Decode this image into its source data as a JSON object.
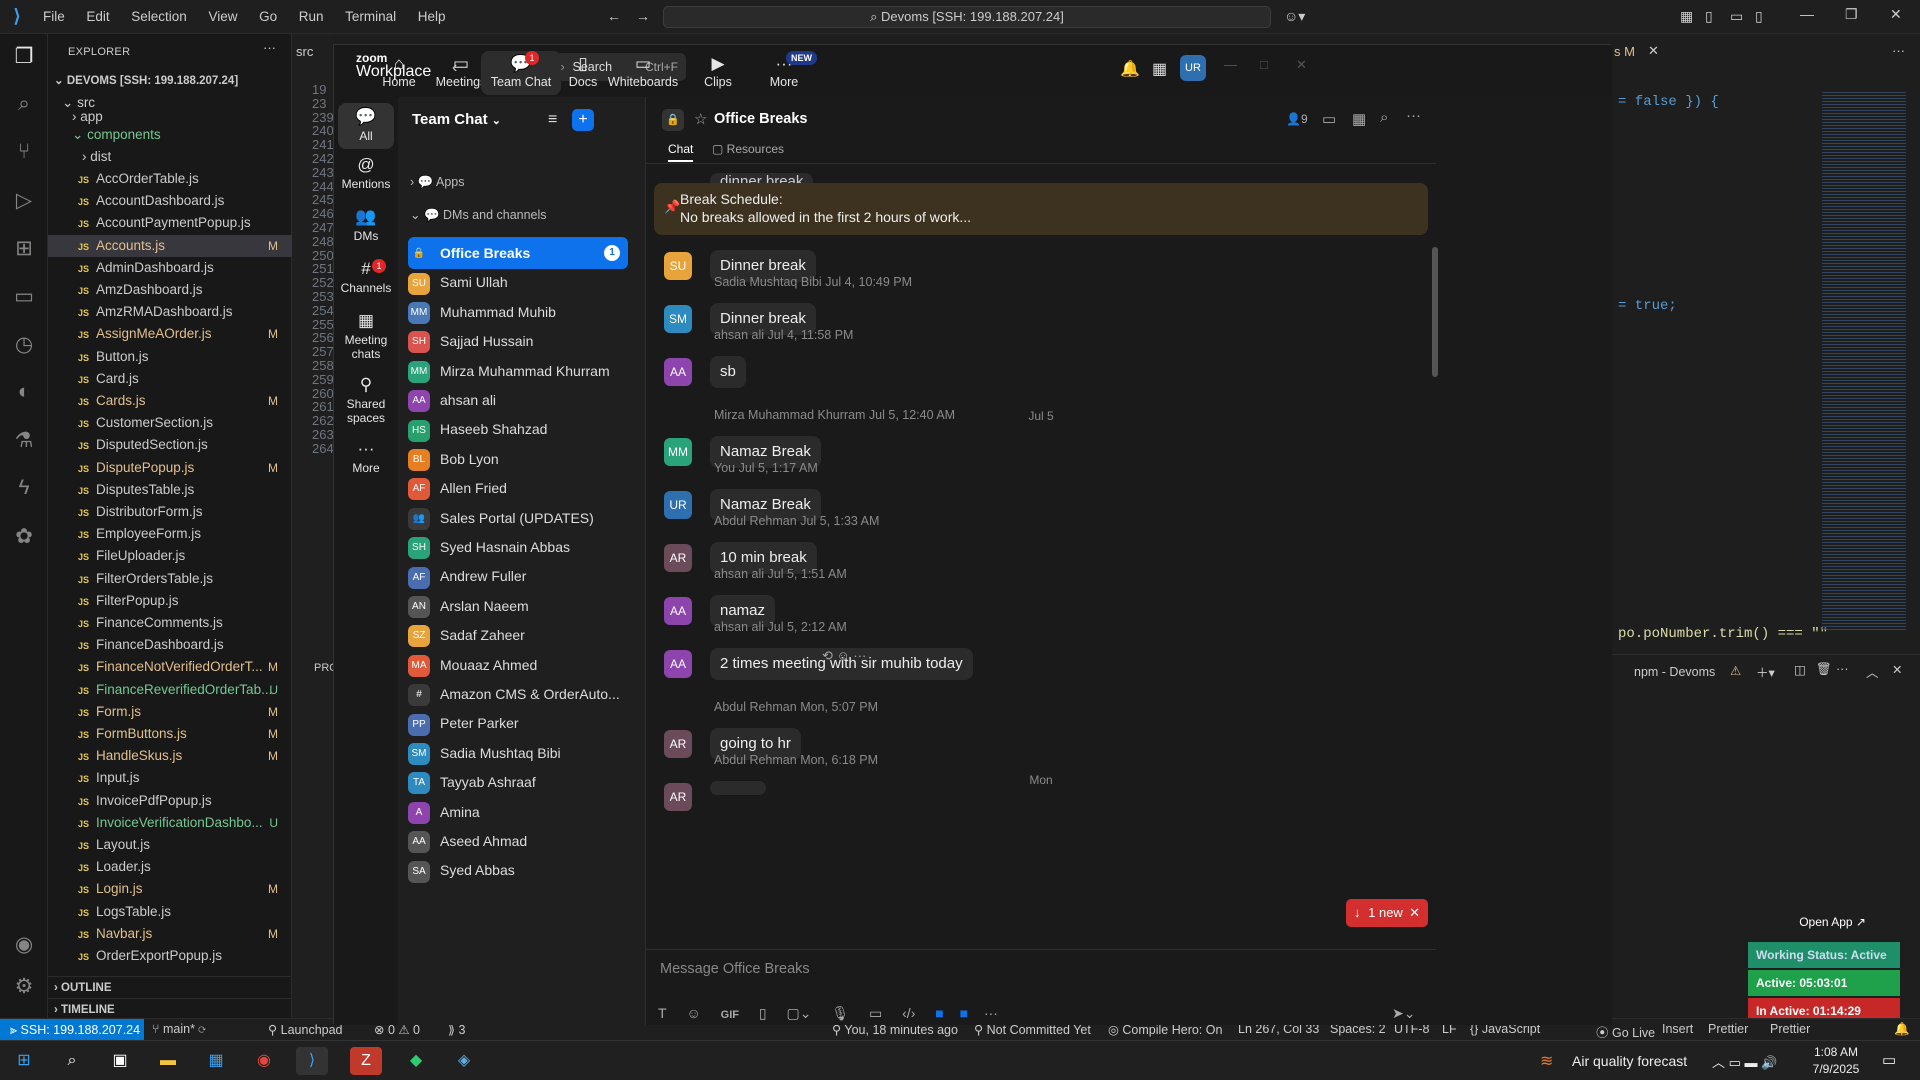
{
  "vscode": {
    "menu": [
      "File",
      "Edit",
      "Selection",
      "View",
      "Go",
      "Run",
      "Terminal",
      "Help"
    ],
    "command_center": "Devoms [SSH: 199.188.207.24]",
    "explorer_title": "EXPLORER",
    "root": "DEVOMS [SSH: 199.188.207.24]",
    "folders": {
      "src": "src",
      "app": "app",
      "components": "components",
      "dist": "dist"
    },
    "files": [
      {
        "name": "AccOrderTable.js",
        "status": ""
      },
      {
        "name": "AccountDashboard.js",
        "status": ""
      },
      {
        "name": "AccountPaymentPopup.js",
        "status": ""
      },
      {
        "name": "Accounts.js",
        "status": "M"
      },
      {
        "name": "AdminDashboard.js",
        "status": ""
      },
      {
        "name": "AmzDashboard.js",
        "status": ""
      },
      {
        "name": "AmzRMADashboard.js",
        "status": ""
      },
      {
        "name": "AssignMeAOrder.js",
        "status": "M"
      },
      {
        "name": "Button.js",
        "status": ""
      },
      {
        "name": "Card.js",
        "status": ""
      },
      {
        "name": "Cards.js",
        "status": "M"
      },
      {
        "name": "CustomerSection.js",
        "status": ""
      },
      {
        "name": "DisputedSection.js",
        "status": ""
      },
      {
        "name": "DisputePopup.js",
        "status": "M"
      },
      {
        "name": "DisputesTable.js",
        "status": ""
      },
      {
        "name": "DistributorForm.js",
        "status": ""
      },
      {
        "name": "EmployeeForm.js",
        "status": ""
      },
      {
        "name": "FileUploader.js",
        "status": ""
      },
      {
        "name": "FilterOrdersTable.js",
        "status": ""
      },
      {
        "name": "FilterPopup.js",
        "status": ""
      },
      {
        "name": "FinanceComments.js",
        "status": ""
      },
      {
        "name": "FinanceDashboard.js",
        "status": ""
      },
      {
        "name": "FinanceNotVerifiedOrderT...",
        "status": "M"
      },
      {
        "name": "FinanceReverifiedOrderTab...",
        "status": "U"
      },
      {
        "name": "Form.js",
        "status": "M"
      },
      {
        "name": "FormButtons.js",
        "status": "M"
      },
      {
        "name": "HandleSkus.js",
        "status": "M"
      },
      {
        "name": "Input.js",
        "status": ""
      },
      {
        "name": "InvoicePdfPopup.js",
        "status": ""
      },
      {
        "name": "InvoiceVerificationDashbo...",
        "status": "U"
      },
      {
        "name": "Layout.js",
        "status": ""
      },
      {
        "name": "Loader.js",
        "status": ""
      },
      {
        "name": "Login.js",
        "status": "M"
      },
      {
        "name": "LogsTable.js",
        "status": ""
      },
      {
        "name": "Navbar.js",
        "status": "M"
      },
      {
        "name": "OrderExportPopup.js",
        "status": ""
      }
    ],
    "outline": "OUTLINE",
    "timeline": "TIMELINE",
    "line_numbers": [
      "19",
      "23",
      "239",
      "240",
      "241",
      "242",
      "243",
      "244",
      "245",
      "246",
      "247",
      "248",
      "250",
      "251",
      "252",
      "253",
      "254",
      "255",
      "256",
      "257",
      "258",
      "259",
      "260",
      "261",
      "262",
      "263",
      "264"
    ],
    "src_tab": "src",
    "problems_tab": "PRO",
    "right_tab_status": "s M",
    "code_lines": [
      "= false }) {",
      "= true;",
      "po.poNumber.trim() === \"\""
    ],
    "terminal_label": "npm - Devoms",
    "open_app": "Open App ↗",
    "working_status": "Working Status: Active",
    "active_time": "Active: 05:03:01",
    "inactive_time": "In Active: 01:14:29",
    "status": {
      "remote": "SSH: 199.188.207.24",
      "branch": "main*",
      "launchpad": "Launchpad",
      "problems": "⊗ 0 ⚠ 0",
      "ports": "3",
      "blame": "You, 18 minutes ago",
      "commit": "Not Committed Yet",
      "compile": "Compile Hero: On",
      "position": "Ln 267, Col 33",
      "spaces": "Spaces: 2",
      "encoding": "UTF-8",
      "eol": "LF",
      "language": "JavaScript",
      "golive": "Go Live",
      "insert": "Insert",
      "prettier1": "Prettier",
      "prettier2": "Prettier"
    }
  },
  "zoom": {
    "logo_line1": "zoom",
    "logo_line2": "Workplace",
    "search": "Search",
    "search_shortcut": "Ctrl+F",
    "nav": [
      {
        "label": "Home",
        "icon": "home-icon"
      },
      {
        "label": "Meetings",
        "icon": "video-icon"
      },
      {
        "label": "Team Chat",
        "icon": "chat-icon",
        "badge": "1"
      },
      {
        "label": "Docs",
        "icon": "doc-icon"
      },
      {
        "label": "Whiteboards",
        "icon": "whiteboard-icon"
      },
      {
        "label": "Clips",
        "icon": "clips-icon"
      },
      {
        "label": "More",
        "icon": "more-icon",
        "badge": "NEW"
      }
    ],
    "avatar": "UR",
    "rail": [
      {
        "label": "All"
      },
      {
        "label": "Mentions"
      },
      {
        "label": "DMs"
      },
      {
        "label": "Channels",
        "badge": "1"
      },
      {
        "label": "Meeting chats"
      },
      {
        "label": "Shared spaces"
      },
      {
        "label": "More"
      }
    ],
    "list_title": "Team Chat",
    "apps": "Apps",
    "dms_channels": "DMs and channels",
    "channels": [
      {
        "name": "Office Breaks",
        "av": "🔒",
        "color": "#0e72ed",
        "badge": "1"
      },
      {
        "name": "Sami Ullah",
        "av": "SU",
        "color": "#e8a33d"
      },
      {
        "name": "Muhammad Muhib",
        "av": "MM",
        "color": "#4a78b6"
      },
      {
        "name": "Sajjad Hussain",
        "av": "SH",
        "color": "#d9534f"
      },
      {
        "name": "Mirza Muhammad Khurram",
        "av": "MM",
        "color": "#2aa37a"
      },
      {
        "name": "ahsan ali",
        "av": "AA",
        "color": "#8e44ad"
      },
      {
        "name": "Haseeb Shahzad",
        "av": "HS",
        "color": "#27a06e"
      },
      {
        "name": "Bob Lyon",
        "av": "BL",
        "color": "#e67e22"
      },
      {
        "name": "Allen Fried",
        "av": "AF",
        "color": "#e05a3a"
      },
      {
        "name": "Sales Portal (UPDATES)",
        "av": "👥",
        "color": "#3a3a3a"
      },
      {
        "name": "Syed Hasnain Abbas",
        "av": "SH",
        "color": "#2aa37a"
      },
      {
        "name": "Andrew Fuller",
        "av": "AF",
        "color": "#4a6db0"
      },
      {
        "name": "Arslan Naeem",
        "av": "AN",
        "color": "#555"
      },
      {
        "name": "Sadaf Zaheer",
        "av": "SZ",
        "color": "#e8a33d"
      },
      {
        "name": "Mouaaz Ahmed",
        "av": "MA",
        "color": "#e05a3a"
      },
      {
        "name": "Amazon CMS & OrderAuto...",
        "av": "#",
        "color": "#3a3a3a"
      },
      {
        "name": "Peter Parker",
        "av": "PP",
        "color": "#4a6db0"
      },
      {
        "name": "Sadia Mushtaq Bibi",
        "av": "SM",
        "color": "#2e8bc0"
      },
      {
        "name": "Tayyab Ashraaf",
        "av": "TA",
        "color": "#2e8bc0"
      },
      {
        "name": "Amina",
        "av": "A",
        "color": "#8e44ad"
      },
      {
        "name": "Aseed Ahmad",
        "av": "AA",
        "color": "#555"
      },
      {
        "name": "Syed Abbas",
        "av": "SA",
        "color": "#555"
      }
    ],
    "chat_title": "Office Breaks",
    "member_count": "9",
    "tab_chat": "Chat",
    "tab_resources": "Resources",
    "pinned_title": "Break Schedule:",
    "pinned_text": "No breaks allowed in the first 2 hours of work...",
    "partial_top": "dinner break",
    "messages": [
      {
        "sender": "",
        "time": "",
        "text": "Dinner break",
        "av": "SU",
        "color": "#e8a33d"
      },
      {
        "sender": "Sadia Mushtaq Bibi",
        "time": "Jul 4, 10:49 PM",
        "text": "Dinner break",
        "av": "SM",
        "color": "#2e8bc0"
      },
      {
        "sender": "ahsan ali",
        "time": "Jul 4, 11:58 PM",
        "text": "sb",
        "av": "AA",
        "color": "#8e44ad"
      },
      {
        "sender": "Mirza Muhammad Khurram",
        "time": "Jul 5, 12:40 AM",
        "text": "Namaz Break",
        "av": "MM",
        "color": "#2aa37a"
      },
      {
        "sender": "You",
        "time": "Jul 5, 1:17 AM",
        "text": "Namaz Break",
        "av": "UR",
        "color": "#2e6fb0"
      },
      {
        "sender": "Abdul Rehman",
        "time": "Jul 5, 1:33 AM",
        "text": "10 min break",
        "av": "AR",
        "color": "#6b4a5a"
      },
      {
        "sender": "ahsan ali",
        "time": "Jul 5, 1:51 AM",
        "text": "namaz",
        "av": "AA",
        "color": "#8e44ad"
      },
      {
        "sender": "ahsan ali",
        "time": "Jul 5, 2:12 AM",
        "text": "2 times meeting with sir muhib today",
        "av": "AA",
        "color": "#8e44ad"
      },
      {
        "sender": "Abdul Rehman",
        "time": "Mon, 5:07 PM",
        "text": "going to hr",
        "av": "AR",
        "color": "#6b4a5a"
      },
      {
        "sender": "Abdul Rehman",
        "time": "Mon, 6:18 PM",
        "text": "",
        "av": "AR",
        "color": "#6b4a5a"
      }
    ],
    "day_jul5": "Jul 5",
    "day_mon": "Mon",
    "new_badge": "1 new",
    "composer_placeholder": "Message Office Breaks",
    "gif": "GIF"
  },
  "taskbar": {
    "weather": "Air quality forecast",
    "time": "1:08 AM",
    "date": "7/9/2025"
  }
}
